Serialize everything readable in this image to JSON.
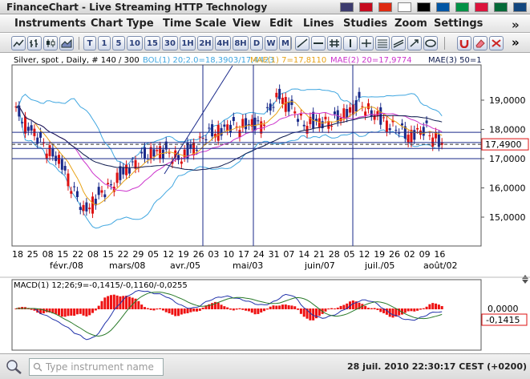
{
  "window": {
    "title": "FinanceChart - Live Streaming HTTP Technology"
  },
  "flags": [
    {
      "name": "us-flag-icon",
      "color": "#3c3b6e"
    },
    {
      "name": "spain-flag-icon",
      "color": "#c60b1e"
    },
    {
      "name": "china-flag-icon",
      "color": "#de2910"
    },
    {
      "name": "japan-flag-icon",
      "color": "#ffffff"
    },
    {
      "name": "germany-flag-icon",
      "color": "#000000"
    },
    {
      "name": "france-flag-icon",
      "color": "#0055a4"
    },
    {
      "name": "italy-flag-icon",
      "color": "#009246"
    },
    {
      "name": "poland-flag-icon",
      "color": "#dc143c"
    },
    {
      "name": "portugal-flag-icon",
      "color": "#046a38"
    },
    {
      "name": "czech-flag-icon",
      "color": "#11457e"
    }
  ],
  "menu": {
    "items": [
      "Instruments",
      "Chart Type",
      "Time Scale",
      "View",
      "Edit",
      "Lines",
      "Studies",
      "Zoom",
      "Settings"
    ],
    "more": "»"
  },
  "toolbar": {
    "timescale": [
      "T",
      "1",
      "5",
      "10",
      "15",
      "30",
      "1H",
      "2H",
      "4H",
      "8H",
      "D",
      "W",
      "M"
    ],
    "more": "»"
  },
  "chart": {
    "title": "Silver, spot , Daily, # 140 / 300",
    "legend": [
      {
        "text": "BOL(1) 20;2.0=18,3903/17,4423",
        "color": "#3fa6e0"
      },
      {
        "text": "MAE(1) 7=17,8110",
        "color": "#e8a317"
      },
      {
        "text": "MAE(2) 20=17,9774",
        "color": "#cc33cc"
      },
      {
        "text": "MAE(3) 50=1",
        "color": "#0d1a4d"
      }
    ],
    "last_price": "17,4900",
    "y_labels": [
      "19,0000",
      "18,0000",
      "17,0000",
      "16,0000",
      "15,0000"
    ],
    "x_day_labels": [
      "18",
      "25",
      "08",
      "15",
      "22",
      "08",
      "15",
      "22",
      "29",
      "05",
      "12",
      "19",
      "26",
      "03",
      "10",
      "17",
      "24",
      "31",
      "07",
      "14",
      "21",
      "28",
      "05",
      "12",
      "19",
      "26",
      "02",
      "09",
      "16"
    ],
    "x_month_labels": [
      "févr./08",
      "mars/08",
      "avr./05",
      "mai/03",
      "juin/07",
      "juil./05",
      "août/02"
    ],
    "colors": {
      "up": "#1a2a8a",
      "down": "#dd1111",
      "boll": "#3fa6e0",
      "ma7": "#e8a317",
      "ma20": "#cc33cc",
      "ma50": "#0d1a4d"
    }
  },
  "macd": {
    "label": "MACD(1) 12;26;9=-0,1415/-0,1160/-0,0255",
    "y_labels": [
      "0,0000",
      "-0,1415"
    ],
    "colors": {
      "hist": "#ee1111",
      "macd": "#2233aa",
      "signal": "#2a7a2a"
    }
  },
  "status": {
    "search_placeholder": "Type instrument name",
    "timestamp": "28 juil. 2010 22:30:17  CEST (+0200)"
  }
}
